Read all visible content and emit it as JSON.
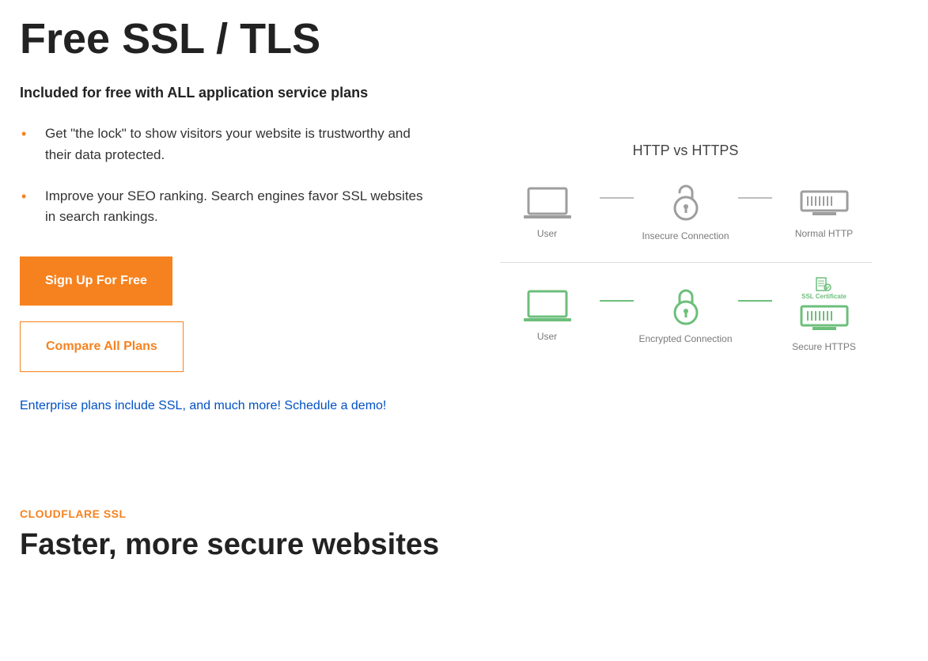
{
  "hero": {
    "title": "Free SSL / TLS",
    "subhead": "Included for free with ALL application service plans",
    "bullets": [
      "Get \"the lock\" to show visitors your website is trustworthy and their data protected.",
      "Improve your SEO ranking. Search engines favor SSL websites in search rankings."
    ],
    "primary_cta": "Sign Up For Free",
    "secondary_cta": "Compare All Plans",
    "enterprise_link": "Enterprise plans include SSL, and much more! Schedule a demo!"
  },
  "diagram": {
    "title": "HTTP vs HTTPS",
    "row1": {
      "user": "User",
      "mid": "Insecure Connection",
      "right": "Normal HTTP"
    },
    "row2": {
      "user": "User",
      "mid": "Encrypted Connection",
      "right": "Secure HTTPS",
      "cert": "SSL Certificate"
    }
  },
  "section2": {
    "eyebrow": "CLOUDFLARE SSL",
    "title": "Faster, more secure websites"
  }
}
